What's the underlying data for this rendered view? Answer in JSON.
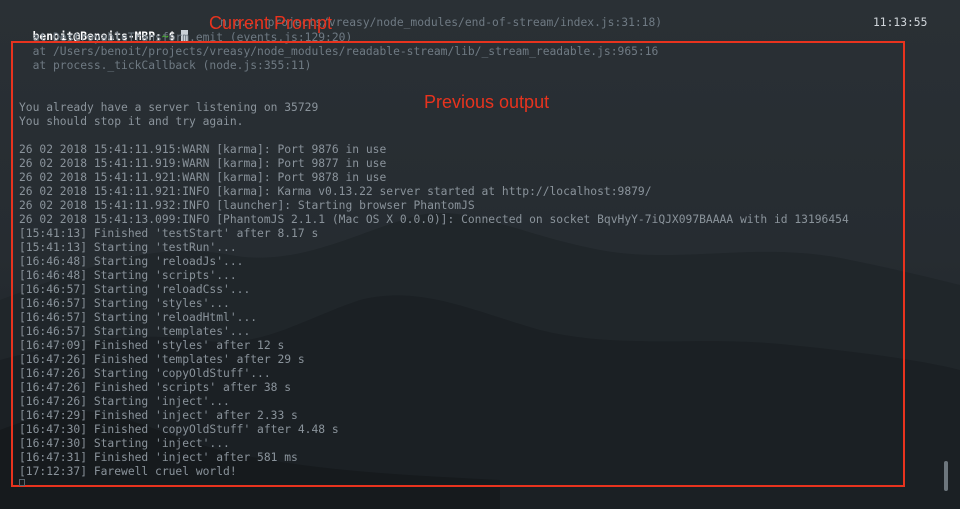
{
  "terminal": {
    "prompt": {
      "user": "benoit@Benoits-MBP:",
      "tilde": "~",
      "symbol": "$"
    },
    "obscured_tail": "n.o... projects/vreasy/node_modules/end-of-stream/index.js:31:18)",
    "clock": "11:13:55",
    "lines": [
      "  at DestroyableTransform.emit (events.js:129:20)",
      "  at /Users/benoit/projects/vreasy/node_modules/readable-stream/lib/_stream_readable.js:965:16",
      "  at process._tickCallback (node.js:355:11)",
      "",
      "",
      "You already have a server listening on 35729",
      "You should stop it and try again.",
      "",
      "26 02 2018 15:41:11.915:WARN [karma]: Port 9876 in use",
      "26 02 2018 15:41:11.919:WARN [karma]: Port 9877 in use",
      "26 02 2018 15:41:11.921:WARN [karma]: Port 9878 in use",
      "26 02 2018 15:41:11.921:INFO [karma]: Karma v0.13.22 server started at http://localhost:9879/",
      "26 02 2018 15:41:11.932:INFO [launcher]: Starting browser PhantomJS",
      "26 02 2018 15:41:13.099:INFO [PhantomJS 2.1.1 (Mac OS X 0.0.0)]: Connected on socket BqvHyY-7iQJX097BAAAA with id 13196454",
      "[15:41:13] Finished 'testStart' after 8.17 s",
      "[15:41:13] Starting 'testRun'...",
      "[16:46:48] Starting 'reloadJs'...",
      "[16:46:48] Starting 'scripts'...",
      "[16:46:57] Starting 'reloadCss'...",
      "[16:46:57] Starting 'styles'...",
      "[16:46:57] Starting 'reloadHtml'...",
      "[16:46:57] Starting 'templates'...",
      "[16:47:09] Finished 'styles' after 12 s",
      "[16:47:26] Finished 'templates' after 29 s",
      "[16:47:26] Starting 'copyOldStuff'...",
      "[16:47:26] Finished 'scripts' after 38 s",
      "[16:47:26] Starting 'inject'...",
      "[16:47:29] Finished 'inject' after 2.33 s",
      "[16:47:30] Finished 'copyOldStuff' after 4.48 s",
      "[16:47:30] Starting 'inject'...",
      "[16:47:31] Finished 'inject' after 581 ms",
      "[17:12:37] Farewell cruel world!"
    ]
  },
  "annotations": {
    "current_prompt": "Current Prompt",
    "previous_output": "Previous output",
    "color": "#e8331e"
  },
  "colors": {
    "background": "#23292e",
    "text": "#8a939b",
    "prompt_tilde": "#43b02a"
  }
}
